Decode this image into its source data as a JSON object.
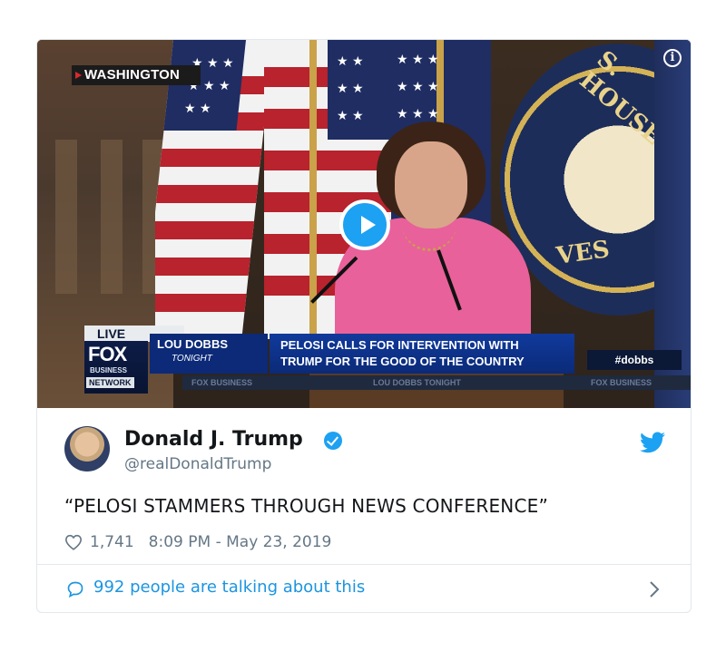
{
  "video": {
    "location_badge": "WASHINGTON",
    "live_label": "LIVE",
    "network_logo": "FOX",
    "network_sub": "BUSINESS",
    "network_label": "NETWORK",
    "show_name": "LOU DOBBS",
    "show_sub": "TONIGHT",
    "headline_line1": "PELOSI CALLS FOR INTERVENTION WITH",
    "headline_line2": "TRUMP FOR THE GOOD OF THE COUNTRY",
    "hashtag": "#dobbs",
    "ticker_items": [
      "FOX BUSINESS",
      "LOU DOBBS TONIGHT",
      "FOX BUSINESS"
    ],
    "seal_text": "U.S. HOUSE OF REPRESENTATIVES",
    "play_icon": "play-icon",
    "info_icon": "info-icon"
  },
  "tweet": {
    "display_name": "Donald J. Trump",
    "handle": "@realDonaldTrump",
    "text": "“PELOSI STAMMERS THROUGH NEWS CONFERENCE”",
    "likes": "1,741",
    "timestamp": "8:09 PM - May 23, 2019",
    "verified_icon": "verified-badge-icon",
    "brand_icon": "twitter-bird-icon"
  },
  "footer": {
    "conversation_text": "992 people are talking about this"
  },
  "colors": {
    "twitter_blue": "#1da1f2",
    "link_blue": "#1b95e0",
    "text_dark": "#14171a",
    "text_gray": "#657786",
    "pink_jacket": "#e8619a"
  }
}
